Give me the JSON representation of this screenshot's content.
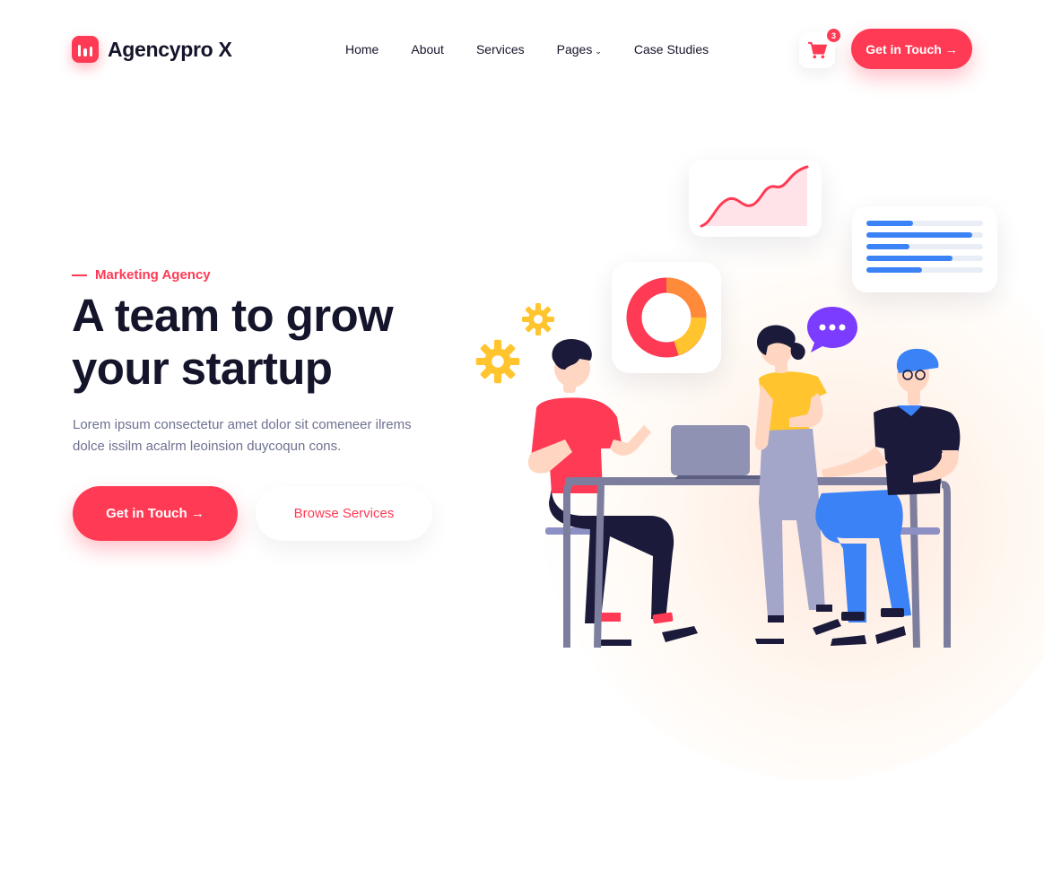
{
  "brand": {
    "name": "Agencypro X",
    "accent": "#ff3a54",
    "dark": "#14142b",
    "muted": "#6e7191"
  },
  "nav": {
    "items": [
      {
        "label": "Home"
      },
      {
        "label": "About"
      },
      {
        "label": "Services"
      },
      {
        "label": "Pages",
        "icon": "chevron-down-icon"
      },
      {
        "label": "Case Studies"
      }
    ]
  },
  "header": {
    "cart": {
      "icon": "cart-icon",
      "count": "3"
    },
    "cta_label": "Get in Touch"
  },
  "hero": {
    "tagline": "Marketing Agency",
    "headline_line1": "A team to grow",
    "headline_line2": "your startup",
    "description": "Lorem ipsum consectetur amet dolor sit comeneer ilrems dolce issilm acalrm leoinsion duycoqun cons.",
    "primary_cta": "Get in Touch",
    "secondary_cta": "Browse Services"
  },
  "illustration": {
    "icons": [
      "line-chart-card-icon",
      "donut-chart-card-icon",
      "bar-list-card-icon",
      "gear-icon",
      "chat-bubble-icon",
      "laptop-icon"
    ],
    "colors": {
      "red": "#ff3a54",
      "yellow": "#ffc42e",
      "blue": "#3b82f6",
      "purple": "#7b3cff",
      "navy": "#1b1a3a",
      "steel": "#7d7e9e"
    }
  }
}
